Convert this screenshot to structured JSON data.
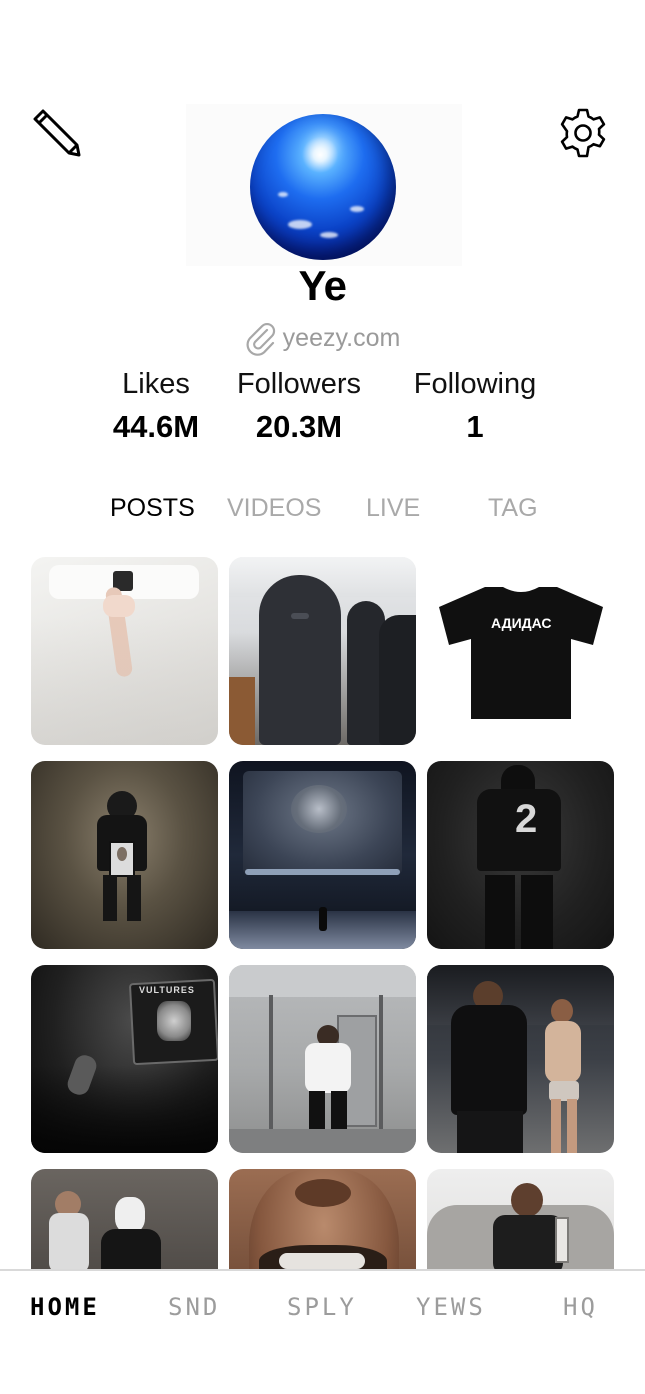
{
  "header": {
    "edit_icon": "pencil-icon",
    "settings_icon": "gear-icon"
  },
  "profile": {
    "name": "Ye",
    "link_icon": "paperclip-icon",
    "link_text": "yeezy.com"
  },
  "stats": {
    "likes_label": "Likes",
    "likes_value": "44.6M",
    "followers_label": "Followers",
    "followers_value": "20.3M",
    "following_label": "Following",
    "following_value": "1"
  },
  "tabs": [
    {
      "label": "POSTS",
      "active": true
    },
    {
      "label": "VIDEOS",
      "active": false
    },
    {
      "label": "LIVE",
      "active": false
    },
    {
      "label": "TAG",
      "active": false
    }
  ],
  "posts": {
    "tshirt_text": "АДИДАС",
    "jersey_number": "2",
    "banner_text": "VULTURES"
  },
  "bottom_nav": [
    {
      "label": "HOME",
      "active": true
    },
    {
      "label": "SND",
      "active": false
    },
    {
      "label": "SPLY",
      "active": false
    },
    {
      "label": "YEWS",
      "active": false
    },
    {
      "label": "HQ",
      "active": false
    }
  ],
  "colors": {
    "accent_active": "#000000",
    "inactive": "#a9a9a9",
    "avatar_blue": "#1e6df0"
  }
}
